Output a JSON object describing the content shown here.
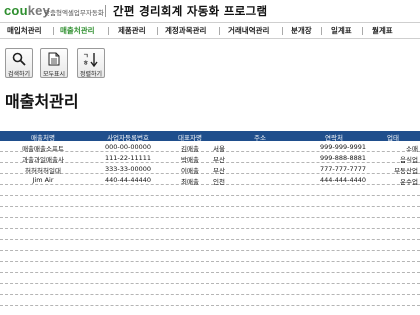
{
  "header": {
    "logo_part1": "cou",
    "logo_part2": "key",
    "tagline": "맞춤형엑셀업무자동화",
    "title": "간편 경리회계 자동화 프로그램"
  },
  "nav": {
    "items": [
      {
        "label": "매입처관리",
        "active": false
      },
      {
        "label": "매출처관리",
        "active": true
      },
      {
        "label": "제품관리",
        "active": false
      },
      {
        "label": "계정과목관리",
        "active": false
      },
      {
        "label": "거래내역관리",
        "active": false
      },
      {
        "label": "분개장",
        "active": false
      },
      {
        "label": "일계표",
        "active": false
      },
      {
        "label": "월계표",
        "active": false
      }
    ]
  },
  "toolbar": {
    "search_label": "검색하기",
    "show_all_label": "모두표시",
    "sort_label": "정렬하기"
  },
  "page": {
    "title": "매출처관리"
  },
  "table": {
    "columns": [
      "매출처명",
      "사업자등록번호",
      "대표자명",
      "주소",
      "연락처",
      "업태"
    ],
    "rows": [
      [
        "매출매출소프트",
        "000-00-00000",
        "김매출",
        "서울",
        "999-999-9991",
        "소매"
      ],
      [
        "과출과일매출사",
        "111-22-11111",
        "박매출",
        "부산",
        "999-888-8881",
        "음식업"
      ],
      [
        "허허허허일대",
        "333-33-00000",
        "이매출",
        "부산",
        "777-777-7777",
        "부동산업"
      ],
      [
        "Jim Air",
        "440-44-44440",
        "최매출",
        "인천",
        "444-444-4440",
        "운수업"
      ],
      [
        "",
        "",
        "",
        "",
        "",
        ""
      ],
      [
        "",
        "",
        "",
        "",
        "",
        ""
      ],
      [
        "",
        "",
        "",
        "",
        "",
        ""
      ],
      [
        "",
        "",
        "",
        "",
        "",
        ""
      ],
      [
        "",
        "",
        "",
        "",
        "",
        ""
      ],
      [
        "",
        "",
        "",
        "",
        "",
        ""
      ],
      [
        "",
        "",
        "",
        "",
        "",
        ""
      ],
      [
        "",
        "",
        "",
        "",
        "",
        ""
      ],
      [
        "",
        "",
        "",
        "",
        "",
        ""
      ],
      [
        "",
        "",
        "",
        "",
        "",
        ""
      ],
      [
        "",
        "",
        "",
        "",
        "",
        ""
      ],
      [
        "",
        "",
        "",
        "",
        "",
        ""
      ]
    ]
  },
  "colors": {
    "brand_green": "#2f8f2f",
    "header_blue": "#1f4e8c"
  }
}
